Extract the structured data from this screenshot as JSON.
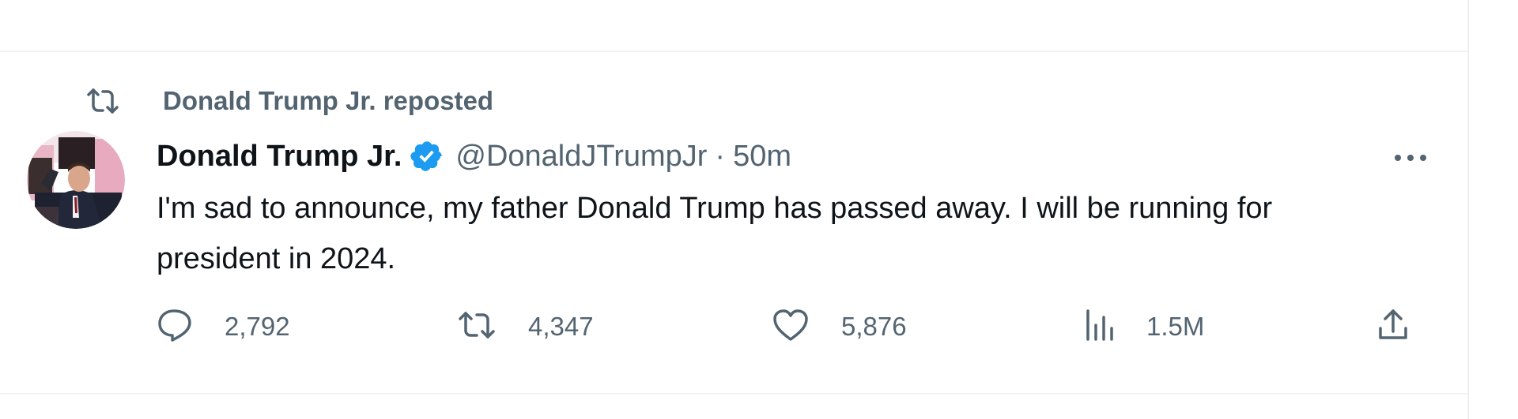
{
  "repost_context": {
    "label": "Donald Trump Jr. reposted",
    "icon": "repost-icon"
  },
  "tweet": {
    "author": {
      "display_name": "Donald Trump Jr.",
      "handle": "@DonaldJTrumpJr",
      "verified": true,
      "avatar": "avatar-photo"
    },
    "separator": "·",
    "timestamp": "50m",
    "text": "I'm sad to announce, my father Donald Trump has passed away. I will be running for president in 2024.",
    "more_icon": "more-icon"
  },
  "actions": {
    "reply": {
      "icon": "reply-icon",
      "count": "2,792"
    },
    "repost": {
      "icon": "repost-icon",
      "count": "4,347"
    },
    "like": {
      "icon": "heart-icon",
      "count": "5,876"
    },
    "views": {
      "icon": "views-icon",
      "count": "1.5M"
    },
    "share": {
      "icon": "share-icon"
    }
  },
  "colors": {
    "primary_text": "#0f1419",
    "secondary_text": "#536471",
    "verified_badge": "#1d9bf0",
    "divider": "#eff3f4"
  }
}
